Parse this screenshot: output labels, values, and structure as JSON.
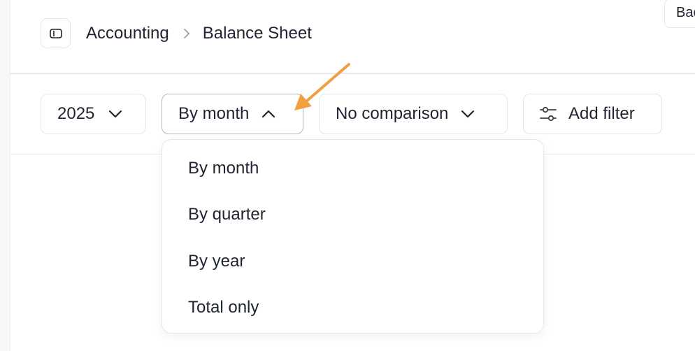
{
  "breadcrumb": {
    "parent": "Accounting",
    "current": "Balance Sheet"
  },
  "header": {
    "back_label": "Back"
  },
  "filters": {
    "year": "2025",
    "period": "By month",
    "comparison": "No comparison",
    "add_filter_label": "Add filter"
  },
  "period_menu": {
    "items": [
      "By month",
      "By quarter",
      "By year",
      "Total only"
    ]
  },
  "colors": {
    "annotation_arrow": "#f0a040",
    "text": "#1f2430",
    "border": "#e3e5e9"
  },
  "icons": {
    "sidebar_toggle": "sidebar-toggle-icon",
    "breadcrumb_separator": "chevron-right-icon",
    "dropdown_closed": "chevron-down-icon",
    "dropdown_open": "chevron-up-icon",
    "add_filter": "sliders-icon"
  }
}
